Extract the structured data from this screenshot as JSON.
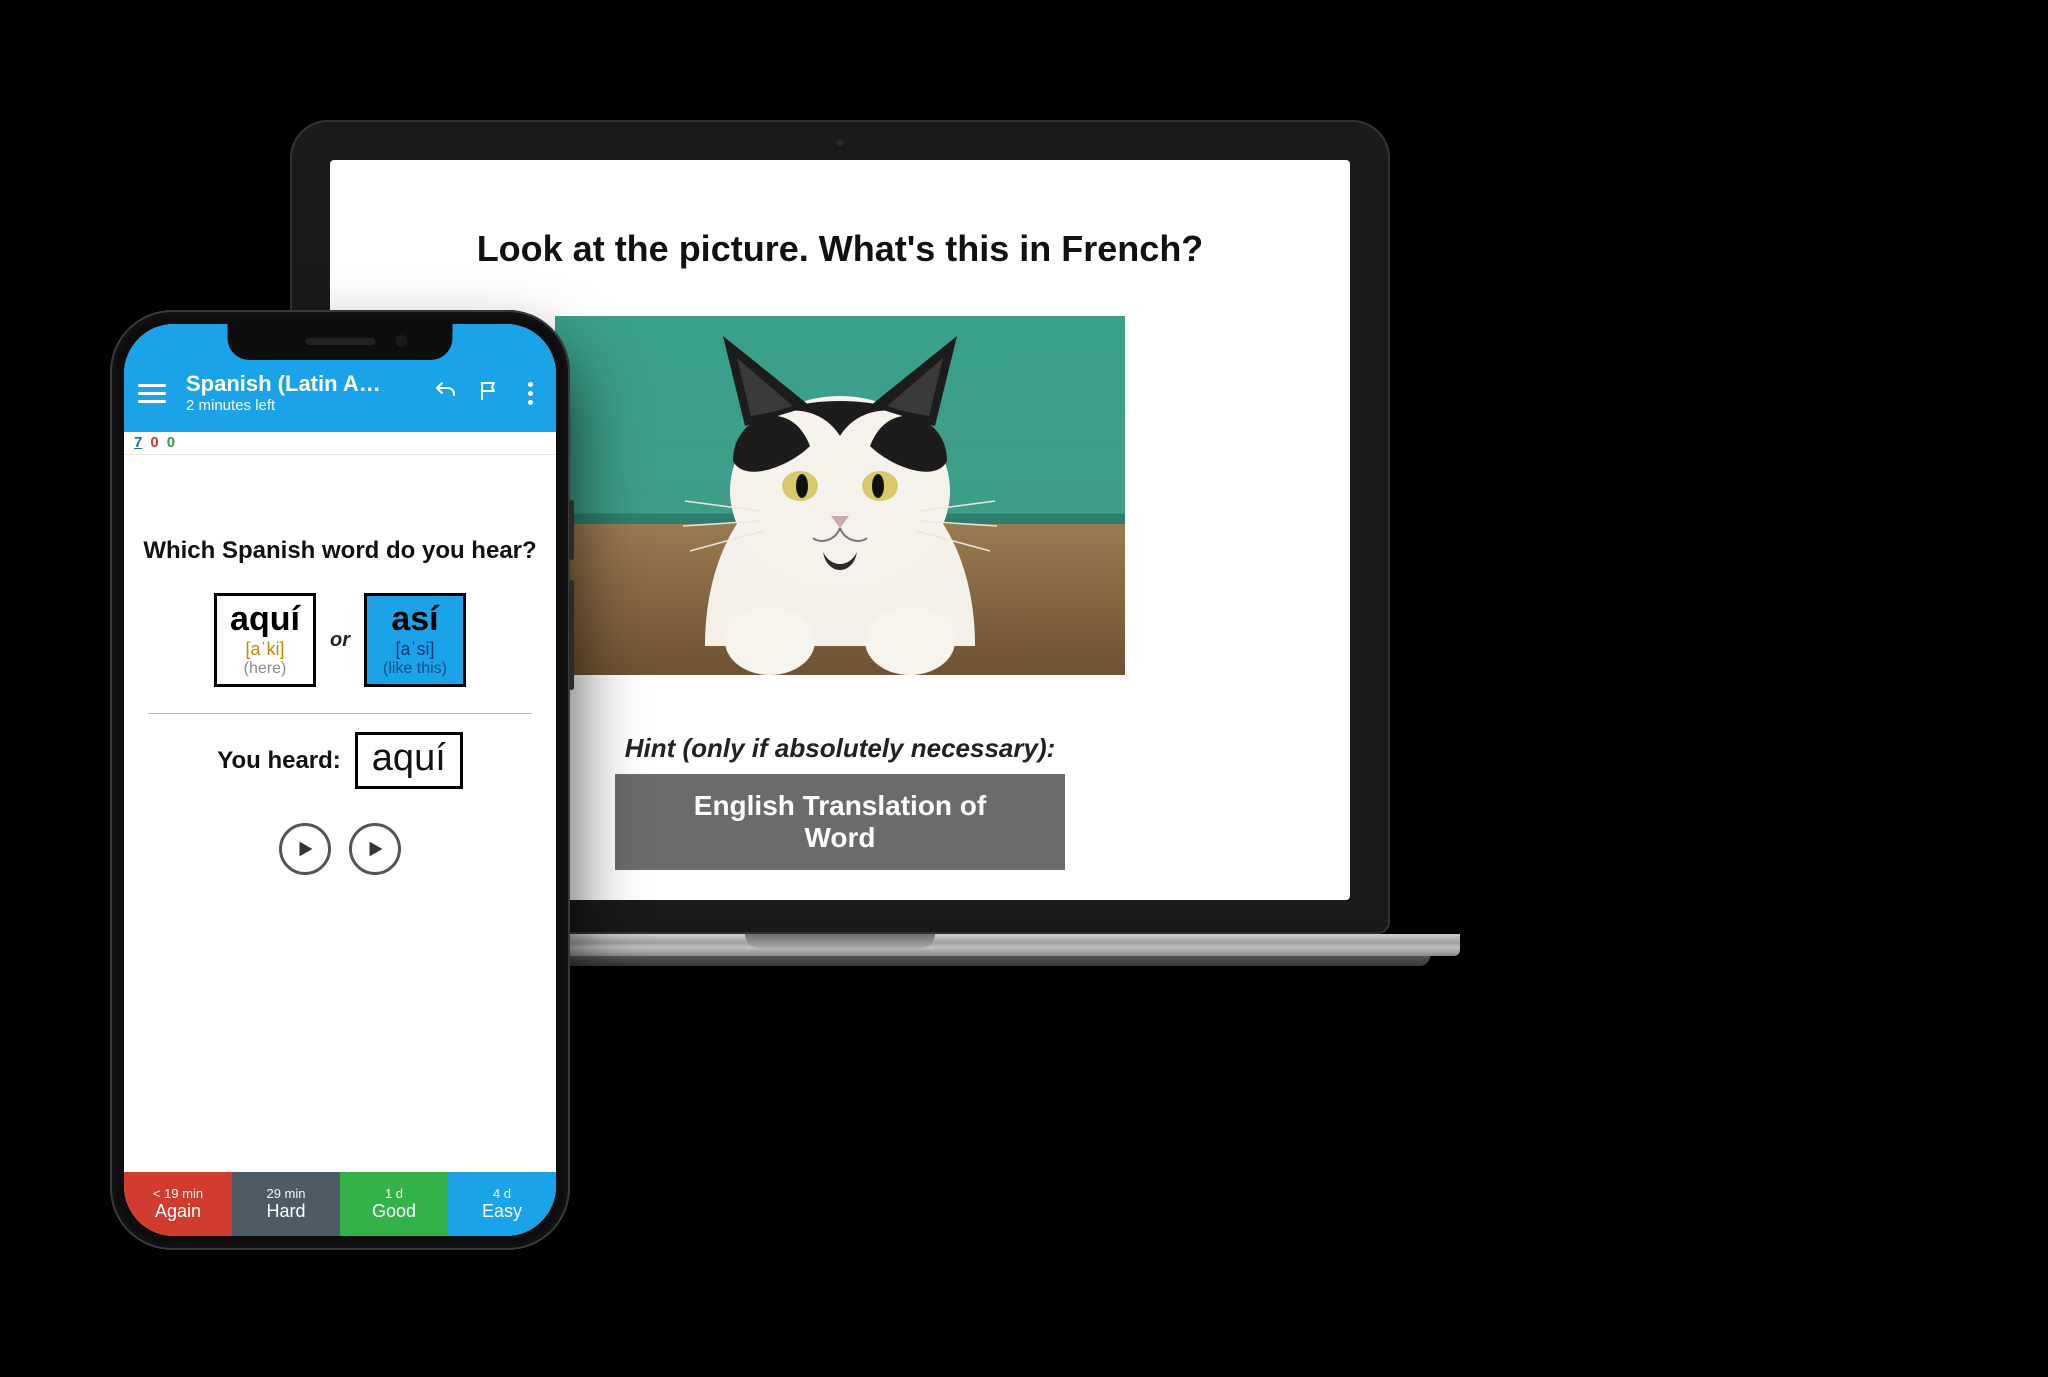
{
  "laptop": {
    "prompt": "Look at the picture. What's this in French?",
    "hint_label": "Hint (only if absolutely necessary):",
    "hint_button": "English Translation of Word",
    "image_subject": "cat"
  },
  "phone": {
    "appbar": {
      "title": "Spanish (Latin A…",
      "subtitle": "2 minutes left"
    },
    "counts": {
      "new": {
        "value": "7",
        "color": "#1a6fb3"
      },
      "learn": {
        "value": "0",
        "color": "#c63a2f"
      },
      "review": {
        "value": "0",
        "color": "#2f9e44"
      }
    },
    "prompt": "Which Spanish word do you hear?",
    "separator": "or",
    "options": [
      {
        "word": "aquí",
        "ipa": "[aˈki]",
        "gloss": "(here)",
        "selected": false
      },
      {
        "word": "así",
        "ipa": "[aˈsi]",
        "gloss": "(like this)",
        "selected": true
      }
    ],
    "heard_label": "You heard:",
    "heard_value": "aquí",
    "answers": [
      {
        "key": "again",
        "time": "< 19 min",
        "label": "Again"
      },
      {
        "key": "hard",
        "time": "29 min",
        "label": "Hard"
      },
      {
        "key": "good",
        "time": "1 d",
        "label": "Good"
      },
      {
        "key": "easy",
        "time": "4 d",
        "label": "Easy"
      }
    ]
  }
}
